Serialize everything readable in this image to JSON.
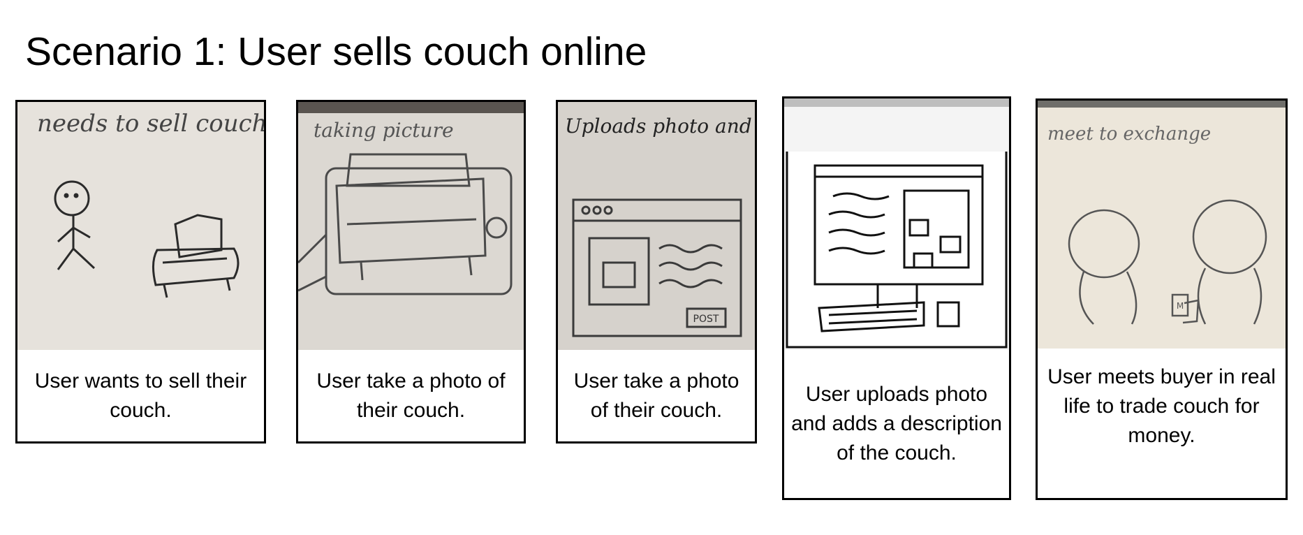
{
  "title": "Scenario 1: User sells couch online",
  "panels": [
    {
      "sketch_label": "needs to sell couch",
      "caption": "User wants to sell their couch.",
      "paper_color": "#e6e2dc"
    },
    {
      "sketch_label": "taking picture",
      "caption": "User take a photo of their couch.",
      "paper_color": "#dcd8d2"
    },
    {
      "sketch_label": "Uploads photo and adds descrip",
      "caption": "User take a photo of their couch.",
      "paper_color": "#d6d2cc",
      "button_label": "POST"
    },
    {
      "sketch_label": "",
      "caption": "User uploads photo and adds a description of the couch.",
      "paper_color": "#f4f4f4"
    },
    {
      "sketch_label": "meet to exchange",
      "caption": "User meets buyer in real life to trade couch for money.",
      "paper_color": "#ece6da",
      "money_label": "M"
    }
  ]
}
